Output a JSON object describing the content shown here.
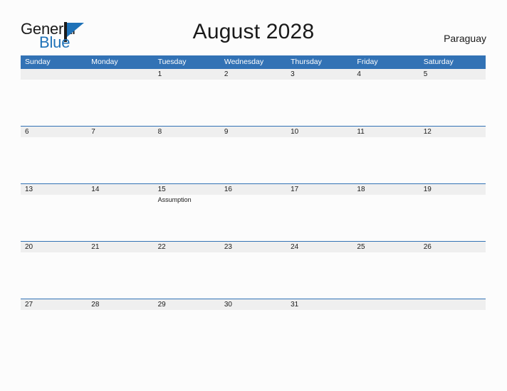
{
  "brand": {
    "name_part1": "General",
    "name_part2": "Blue",
    "logo_icon": "general-blue-triangle-logo"
  },
  "header": {
    "title": "August 2028",
    "country": "Paraguay"
  },
  "calendar": {
    "month": "August",
    "year": "2028",
    "weekday_headers": [
      "Sunday",
      "Monday",
      "Tuesday",
      "Wednesday",
      "Thursday",
      "Friday",
      "Saturday"
    ],
    "colors": {
      "header_blue": "#3272b5",
      "row_band_gray": "#efefef",
      "row_divider_blue": "#3272b5",
      "page_background": "#fcfcfc",
      "brand_blue": "#1f72b8",
      "text_dark": "#1a1a1a"
    },
    "weeks": [
      {
        "days": [
          {
            "number": "",
            "event": ""
          },
          {
            "number": "",
            "event": ""
          },
          {
            "number": "1",
            "event": ""
          },
          {
            "number": "2",
            "event": ""
          },
          {
            "number": "3",
            "event": ""
          },
          {
            "number": "4",
            "event": ""
          },
          {
            "number": "5",
            "event": ""
          }
        ]
      },
      {
        "days": [
          {
            "number": "6",
            "event": ""
          },
          {
            "number": "7",
            "event": ""
          },
          {
            "number": "8",
            "event": ""
          },
          {
            "number": "9",
            "event": ""
          },
          {
            "number": "10",
            "event": ""
          },
          {
            "number": "11",
            "event": ""
          },
          {
            "number": "12",
            "event": ""
          }
        ]
      },
      {
        "days": [
          {
            "number": "13",
            "event": ""
          },
          {
            "number": "14",
            "event": ""
          },
          {
            "number": "15",
            "event": "Assumption"
          },
          {
            "number": "16",
            "event": ""
          },
          {
            "number": "17",
            "event": ""
          },
          {
            "number": "18",
            "event": ""
          },
          {
            "number": "19",
            "event": ""
          }
        ]
      },
      {
        "days": [
          {
            "number": "20",
            "event": ""
          },
          {
            "number": "21",
            "event": ""
          },
          {
            "number": "22",
            "event": ""
          },
          {
            "number": "23",
            "event": ""
          },
          {
            "number": "24",
            "event": ""
          },
          {
            "number": "25",
            "event": ""
          },
          {
            "number": "26",
            "event": ""
          }
        ]
      },
      {
        "days": [
          {
            "number": "27",
            "event": ""
          },
          {
            "number": "28",
            "event": ""
          },
          {
            "number": "29",
            "event": ""
          },
          {
            "number": "30",
            "event": ""
          },
          {
            "number": "31",
            "event": ""
          },
          {
            "number": "",
            "event": ""
          },
          {
            "number": "",
            "event": ""
          }
        ]
      }
    ]
  }
}
